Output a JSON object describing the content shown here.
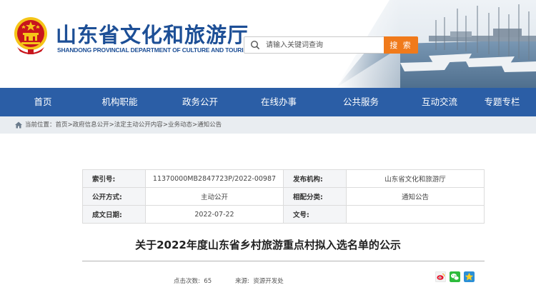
{
  "header": {
    "title": "山东省文化和旅游厅",
    "subtitle": "SHANDONG PROVINCIAL DEPARTMENT OF CULTURE AND TOURISM",
    "search_placeholder": "请输入关键词查询",
    "search_button": "搜 索"
  },
  "nav": {
    "items": [
      {
        "label": "首页"
      },
      {
        "label": "机构职能"
      },
      {
        "label": "政务公开"
      },
      {
        "label": "在线办事"
      },
      {
        "label": "公共服务"
      },
      {
        "label": "互动交流"
      },
      {
        "label": "专题专栏"
      }
    ]
  },
  "breadcrumb": {
    "prefix": "当前位置：",
    "items": [
      "首页",
      "政府信息公开",
      "法定主动公开内容",
      "业务动态",
      "通知公告"
    ],
    "separator": ">"
  },
  "info": {
    "rows": [
      {
        "k1": "索引号:",
        "v1": "11370000MB2847723P/2022-00987",
        "k2": "发布机构:",
        "v2": "山东省文化和旅游厅"
      },
      {
        "k1": "公开方式:",
        "v1": "主动公开",
        "k2": "相配分类:",
        "v2": "通知公告"
      },
      {
        "k1": "成文日期:",
        "v1": "2022-07-22",
        "k2": "文号:",
        "v2": ""
      }
    ]
  },
  "article": {
    "title": "关于2022年度山东省乡村旅游重点村拟入选名单的公示",
    "views_label": "点击次数:",
    "views": "65",
    "source_label": "来源:",
    "source": "资源开发处"
  },
  "colors": {
    "brand_blue": "#1d4f96",
    "nav_blue": "#2b5ea6",
    "search_orange": "#f07a1b",
    "emblem_red": "#c8161d",
    "emblem_gold": "#f5c518"
  },
  "icons": {
    "share": [
      "weibo-icon",
      "wechat-icon",
      "qzone-icon"
    ]
  }
}
